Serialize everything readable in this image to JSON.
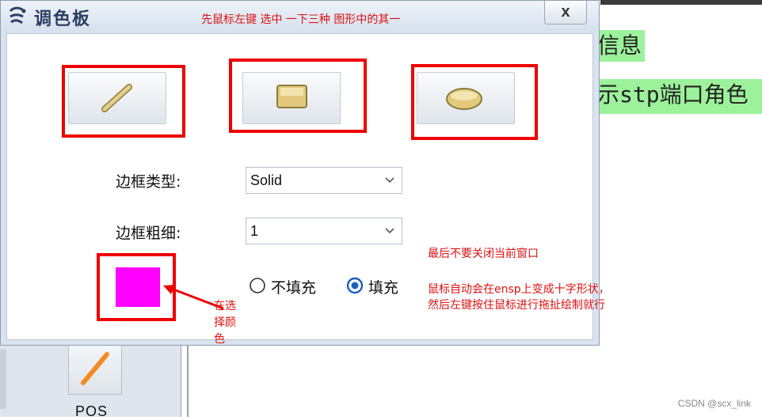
{
  "background": {
    "highlight_1_text": "信息",
    "highlight_2_text": "示stp端口角色",
    "tool_label": "POS",
    "watermark": "CSDN @scx_link"
  },
  "dialog": {
    "title": "调色板",
    "close_label": "x",
    "shape_buttons": [
      {
        "name": "line"
      },
      {
        "name": "rectangle"
      },
      {
        "name": "ellipse"
      }
    ],
    "border_type_label": "边框类型:",
    "border_type_value": "Solid",
    "border_width_label": "边框粗细:",
    "border_width_value": "1",
    "fill_options": [
      {
        "label": "不填充",
        "selected": false
      },
      {
        "label": "填充",
        "selected": true
      }
    ],
    "swatch_color": "#ff00ff"
  },
  "annotations": {
    "top_note": "先鼠标左键 选中 一下三种 图形中的其一",
    "close_note": "最后不要关闭当前窗口",
    "auto_note_line1": "鼠标自动会在ensp上变成十字形状，",
    "auto_note_line2": "然后左键按住鼠标进行拖扯绘制就行",
    "color_note": "在选择颜色",
    "annotation_color": "#ee0000"
  }
}
